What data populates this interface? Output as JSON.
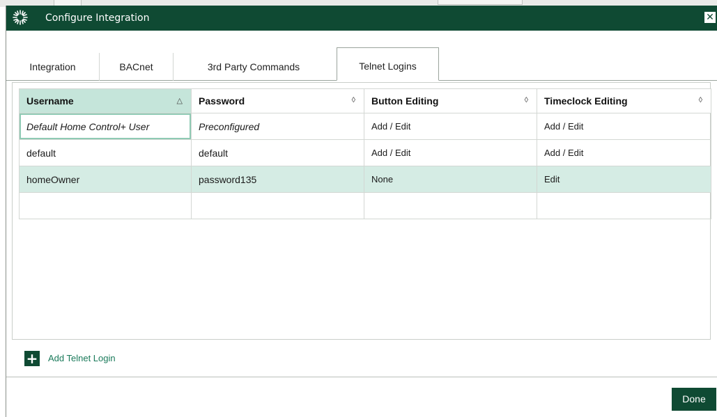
{
  "window": {
    "title": "Configure Integration",
    "close_glyph": "✕",
    "accent_color": "#0f4a33"
  },
  "tabs": [
    {
      "label": "Integration",
      "active": false
    },
    {
      "label": "BACnet",
      "active": false
    },
    {
      "label": "3rd Party Commands",
      "active": false
    },
    {
      "label": "Telnet Logins",
      "active": true
    }
  ],
  "table": {
    "columns": [
      {
        "label": "Username",
        "sort_glyph": "△",
        "sorted": true
      },
      {
        "label": "Password",
        "sort_glyph": "◊"
      },
      {
        "label": "Button Editing",
        "sort_glyph": "◊"
      },
      {
        "label": "Timeclock Editing",
        "sort_glyph": "◊"
      }
    ],
    "rows": [
      {
        "username": "Default Home Control+ User",
        "password": "Preconfigured",
        "button_editing": "Add / Edit",
        "timeclock_editing": "Add / Edit"
      },
      {
        "username": "default",
        "password": "default",
        "button_editing": "Add / Edit",
        "timeclock_editing": "Add / Edit"
      },
      {
        "username": "homeOwner",
        "password": "password135",
        "button_editing": "None",
        "timeclock_editing": "Edit",
        "selected": true
      },
      {
        "username": "",
        "password": "",
        "button_editing": "",
        "timeclock_editing": ""
      }
    ]
  },
  "actions": {
    "add_login_label": "Add Telnet Login",
    "add_glyph": "+",
    "done_label": "Done"
  },
  "icons": {
    "logo": "lutron-starburst-icon",
    "close": "close-icon",
    "add": "plus-icon"
  }
}
